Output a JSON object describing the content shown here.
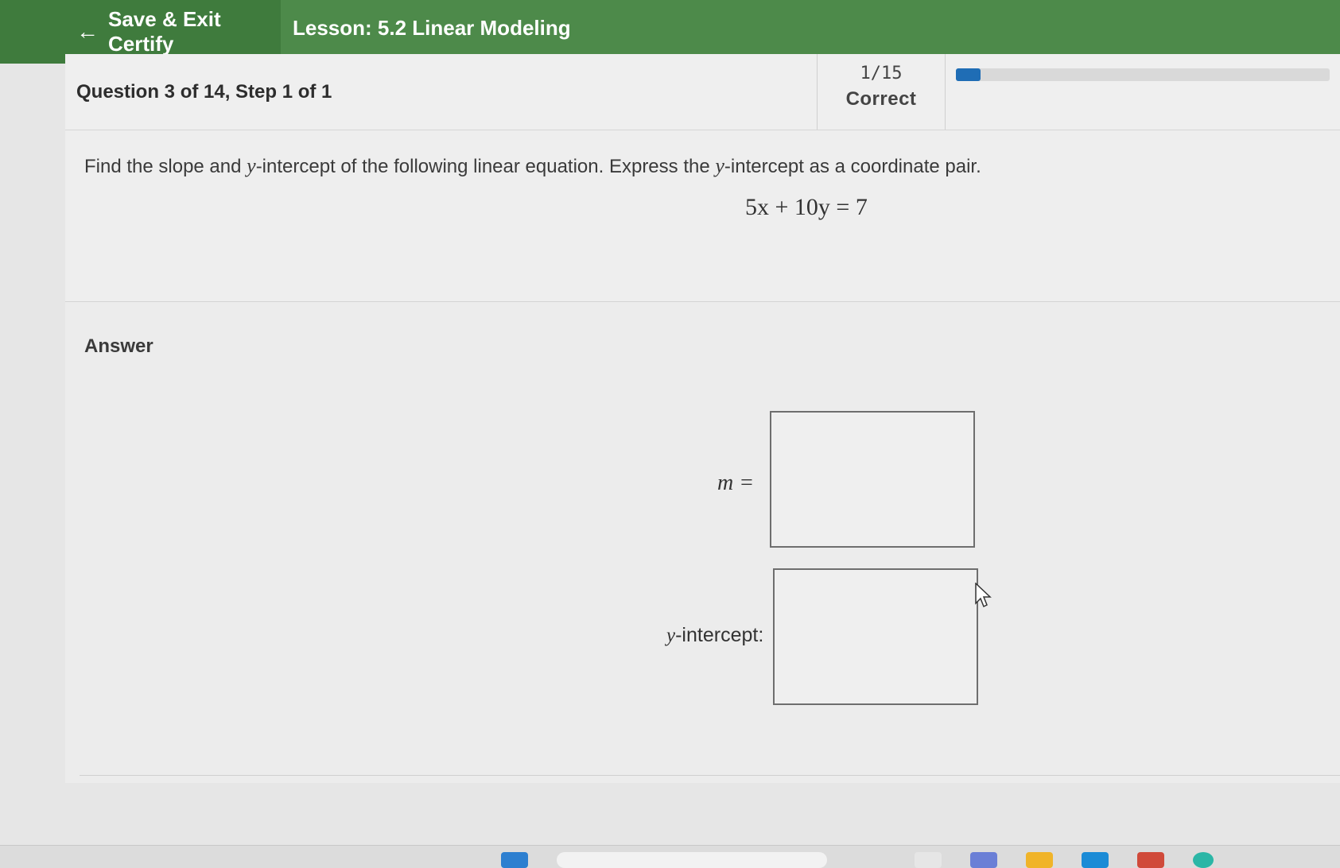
{
  "header": {
    "back_label": "Save & Exit Certify",
    "lesson_title": "Lesson: 5.2 Linear Modeling"
  },
  "question_header": {
    "step_text": "Question 3 of 14, Step 1 of 1",
    "score_fraction": "1/15",
    "score_label": "Correct",
    "progress_fraction": 0.067,
    "progress_color": "#1f6db5"
  },
  "question": {
    "text_before": "Find the slope and ",
    "text_var": "y",
    "text_after": "-intercept of the following linear equation. Express the ",
    "text_var2": "y",
    "text_end": "-intercept as a coordinate pair.",
    "equation": "5x + 10y = 7"
  },
  "answer": {
    "label": "Answer",
    "m_label": "m =",
    "m_value": "",
    "y_label_var": "y",
    "y_label_rest": "-intercept:",
    "y_value": ""
  },
  "icons": {
    "back": "arrow-left-icon",
    "cursor": "mouse-pointer-icon"
  },
  "colors": {
    "topbar": "#4d8a4a",
    "topbar_dark": "#3f7b3d"
  }
}
